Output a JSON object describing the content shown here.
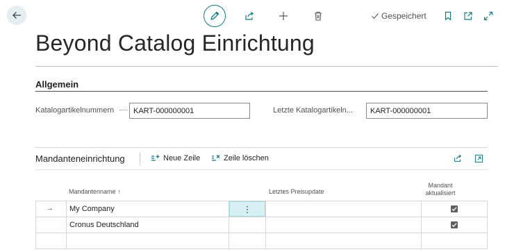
{
  "header": {
    "saved_label": "Gespeichert",
    "icons": [
      "arrow-left-icon",
      "pencil-icon",
      "share-icon",
      "plus-icon",
      "trash-icon",
      "check-icon",
      "bookmark-icon",
      "open-in-new-icon",
      "expand-icon"
    ]
  },
  "page": {
    "title": "Beyond Catalog Einrichtung"
  },
  "general": {
    "title": "Allgemein",
    "fields": [
      {
        "label": "Katalogartikelnummern",
        "value": "KART-000000001"
      },
      {
        "label": "Letzte Katalogartikeln...",
        "value": "KART-000000001"
      }
    ]
  },
  "company_setup": {
    "title": "Mandanteneinrichtung",
    "actions": {
      "new_line": "Neue Zeile",
      "delete_line": "Zeile löschen"
    },
    "columns": {
      "company_name": "Mandantenname",
      "sort_indicator": "↑",
      "last_price_update": "Letztes Preisupdate",
      "company_updated_1": "Mandant",
      "company_updated_2": "aktualisiert"
    },
    "rows": [
      {
        "company_name": "My Company",
        "last_price_update": "",
        "updated": true,
        "selected": true
      },
      {
        "company_name": "Cronus Deutschland",
        "last_price_update": "",
        "updated": true,
        "selected": false
      },
      {
        "company_name": "",
        "last_price_update": "",
        "updated": false,
        "selected": false
      }
    ],
    "row_menu_glyph": "⋮",
    "current_row_glyph": "→"
  },
  "colors": {
    "accent": "#0f7b80",
    "selected_cell": "#d6f0f3"
  }
}
